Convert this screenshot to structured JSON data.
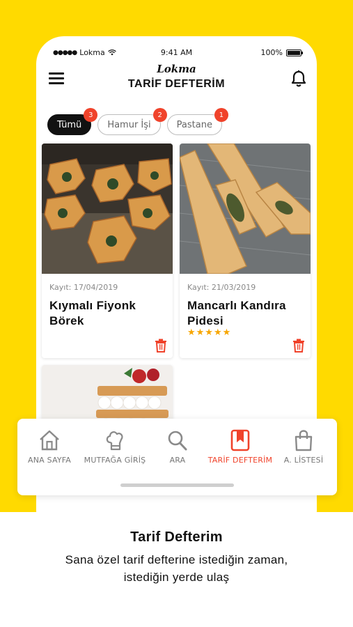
{
  "status_bar": {
    "carrier": "Lokma",
    "time": "9:41 AM",
    "battery": "100%"
  },
  "header": {
    "logo": "Lokma",
    "title": "TARİF DEFTERİM"
  },
  "filters": [
    {
      "label": "Tümü",
      "count": "3",
      "active": true
    },
    {
      "label": "Hamur İşi",
      "count": "2",
      "active": false
    },
    {
      "label": "Pastane",
      "count": "1",
      "active": false
    }
  ],
  "recipes": [
    {
      "date": "Kayıt: 17/04/2019",
      "title": "Kıymalı Fiyonk Börek",
      "rating": 0
    },
    {
      "date": "Kayıt: 21/03/2019",
      "title": "Mancarlı Kandıra Pidesi",
      "rating": 5,
      "stars": "★★★★★"
    }
  ],
  "bottom_nav": [
    {
      "label": "ANA SAYFA",
      "icon": "home-icon",
      "active": false
    },
    {
      "label": "MUTFAĞA GİRİŞ",
      "icon": "chef-hat-icon",
      "active": false
    },
    {
      "label": "ARA",
      "icon": "search-icon",
      "active": false
    },
    {
      "label": "TARİF DEFTERİM",
      "icon": "bookmark-icon",
      "active": true
    },
    {
      "label": "A. LİSTESİ",
      "icon": "shopping-bag-icon",
      "active": false
    }
  ],
  "caption": {
    "title": "Tarif Defterim",
    "subtitle_line1": "Sana özel tarif defterine istediğin zaman,",
    "subtitle_line2": "istediğin yerde ulaş"
  },
  "colors": {
    "brand_yellow": "#FFDA00",
    "accent_red": "#F0432B",
    "star": "#F7A600"
  }
}
